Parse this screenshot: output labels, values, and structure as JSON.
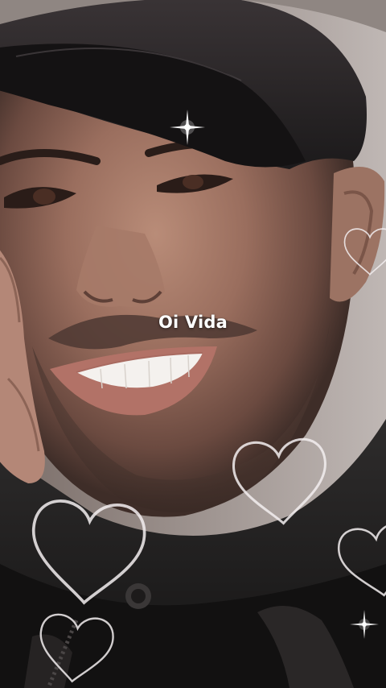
{
  "caption": {
    "text": "Oi Vida"
  },
  "overlay": {
    "icons": [
      "heart-outline-icon",
      "sparkle-icon"
    ],
    "heart_color": "#f3eef0",
    "sparkle_color": "#ffffff"
  }
}
